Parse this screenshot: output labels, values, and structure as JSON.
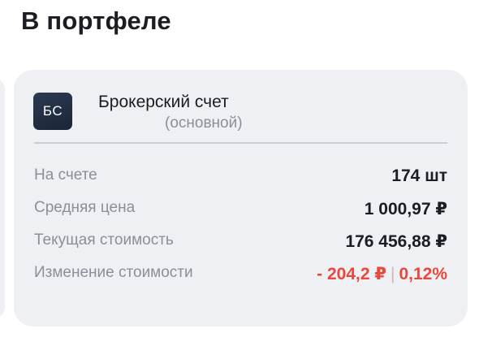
{
  "section": {
    "title": "В портфеле"
  },
  "account": {
    "badge": "БС",
    "title": "Брокерский счет",
    "subtitle": "(основной)"
  },
  "rows": [
    {
      "label": "На счете",
      "value": "174 шт"
    },
    {
      "label": "Средняя цена",
      "value": "1 000,97 ₽"
    },
    {
      "label": "Текущая стоимость",
      "value": "176 456,88 ₽"
    },
    {
      "label": "Изменение стоимости",
      "value_amount": "- 204,2 ₽",
      "separator": "|",
      "value_percent": "0,12%"
    }
  ],
  "colors": {
    "negative": "#e8473c",
    "card_bg": "#eef0f3",
    "badge_bg": "#1c2536"
  }
}
